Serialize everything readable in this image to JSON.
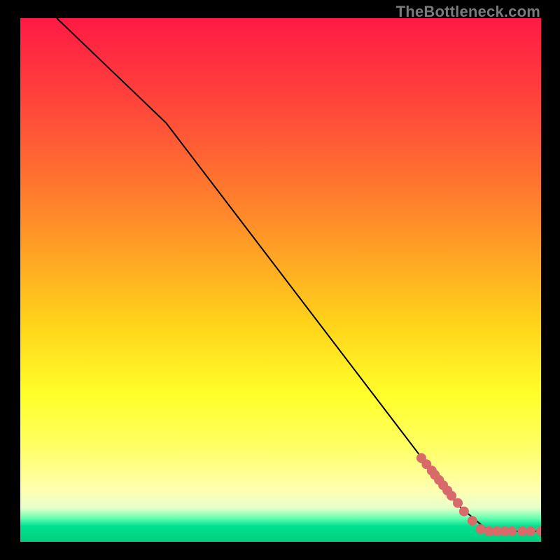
{
  "watermark": "TheBottleneck.com",
  "palette": {
    "frame": "#000000",
    "marker": "#d86a6a",
    "curve": "#000000",
    "gradient_stops": [
      {
        "offset": 0.0,
        "color": "#ff1a44"
      },
      {
        "offset": 0.18,
        "color": "#ff4a3a"
      },
      {
        "offset": 0.38,
        "color": "#ff8a2a"
      },
      {
        "offset": 0.58,
        "color": "#ffd21a"
      },
      {
        "offset": 0.72,
        "color": "#ffff2a"
      },
      {
        "offset": 0.82,
        "color": "#ffff66"
      },
      {
        "offset": 0.9,
        "color": "#ffffb0"
      },
      {
        "offset": 0.935,
        "color": "#e8ffca"
      },
      {
        "offset": 0.955,
        "color": "#66ffb0"
      },
      {
        "offset": 0.97,
        "color": "#00e090"
      },
      {
        "offset": 1.0,
        "color": "#00d080"
      }
    ]
  },
  "chart_data": {
    "type": "line",
    "title": "",
    "xlabel": "",
    "ylabel": "",
    "xlim": [
      0,
      100
    ],
    "ylim": [
      0,
      100
    ],
    "grid": false,
    "legend": false,
    "series": [
      {
        "name": "bottleneck-curve",
        "kind": "line",
        "points": [
          {
            "x": 7.0,
            "y": 100.0
          },
          {
            "x": 28.0,
            "y": 80.0
          },
          {
            "x": 84.0,
            "y": 7.0
          },
          {
            "x": 90.0,
            "y": 2.0
          },
          {
            "x": 100.0,
            "y": 2.0
          }
        ]
      },
      {
        "name": "tail-markers",
        "kind": "scatter",
        "points": [
          {
            "x": 77.0,
            "y": 16.0
          },
          {
            "x": 78.0,
            "y": 14.8
          },
          {
            "x": 79.0,
            "y": 13.6
          },
          {
            "x": 79.6,
            "y": 12.8
          },
          {
            "x": 80.4,
            "y": 11.8
          },
          {
            "x": 81.2,
            "y": 10.8
          },
          {
            "x": 82.0,
            "y": 9.8
          },
          {
            "x": 82.8,
            "y": 8.8
          },
          {
            "x": 84.0,
            "y": 7.4
          },
          {
            "x": 85.2,
            "y": 5.8
          },
          {
            "x": 86.8,
            "y": 4.0
          },
          {
            "x": 88.4,
            "y": 2.4
          },
          {
            "x": 90.0,
            "y": 2.0
          },
          {
            "x": 91.5,
            "y": 2.0
          },
          {
            "x": 93.0,
            "y": 2.0
          },
          {
            "x": 94.4,
            "y": 2.0
          },
          {
            "x": 96.4,
            "y": 2.0
          },
          {
            "x": 98.0,
            "y": 2.0
          },
          {
            "x": 100.0,
            "y": 2.0
          }
        ]
      }
    ]
  }
}
